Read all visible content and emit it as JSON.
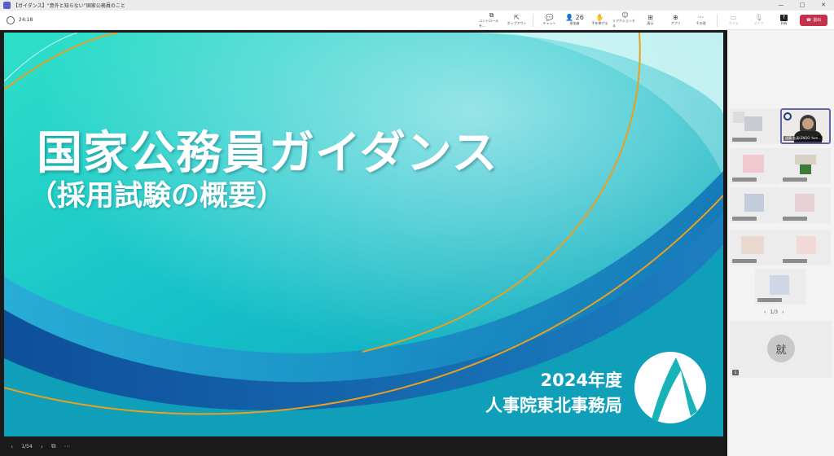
{
  "window": {
    "title": "【ガイダンス】“意外と知らない”国家公務員のこと",
    "controls": [
      "—",
      "□",
      "✕"
    ]
  },
  "toolbar": {
    "timer": "24:18",
    "buttons": [
      {
        "label": "コントロールを...",
        "icon": "⧉",
        "name": "take-control-button",
        "disabled": false
      },
      {
        "label": "ポップアウト",
        "icon": "⇱",
        "name": "popout-button",
        "disabled": false
      },
      {
        "label": "チャット",
        "icon": "💬",
        "name": "chat-button",
        "disabled": false
      },
      {
        "label": "参加者",
        "icon": "👤 26",
        "name": "participants-button",
        "disabled": false
      },
      {
        "label": "手を挙げる",
        "icon": "✋",
        "name": "raise-hand-button",
        "disabled": false
      },
      {
        "label": "リアクションする",
        "icon": "☺",
        "name": "react-button",
        "disabled": false
      },
      {
        "label": "表示",
        "icon": "⊞",
        "name": "view-button",
        "disabled": false
      },
      {
        "label": "アプリ",
        "icon": "⊕",
        "name": "apps-button",
        "disabled": false
      },
      {
        "label": "その他",
        "icon": "···",
        "name": "more-button",
        "disabled": false
      }
    ],
    "media_buttons": [
      {
        "label": "カメラ",
        "icon": "▭",
        "name": "camera-button"
      },
      {
        "label": "マイク",
        "icon": "🎙",
        "name": "mic-button"
      }
    ],
    "share_label": "共有",
    "leave_label": "退出"
  },
  "slide": {
    "title": "国家公務員ガイダンス",
    "subtitle": "（採用試験の概要）",
    "year": "2024年度",
    "org": "人事院東北事務局",
    "page": "1/54"
  },
  "panel": {
    "presenter_label": "遠藤 佑真(ENDO Yum...",
    "pager": "1/3",
    "big_tile_initial": "就",
    "badge": "S"
  },
  "colors": {
    "leave": "#c4314b",
    "accent": "#6264a7",
    "slide_teal": "#17b3b8",
    "slide_blue": "#1b5fa8",
    "gold_line": "#e8a020"
  }
}
